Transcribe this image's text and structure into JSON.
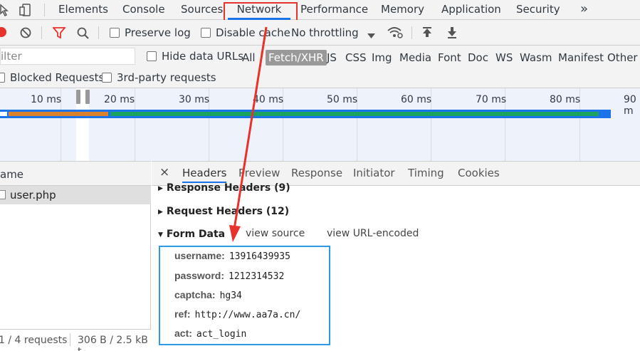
{
  "toolbar_tabs": [
    "Elements",
    "Console",
    "Sources",
    "Network",
    "Performance",
    "Memory",
    "Application",
    "Security"
  ],
  "more_tabs": "»",
  "network_toolbar": {
    "preserve_log": "Preserve log",
    "disable_cache": "Disable cache",
    "throttling": "No throttling"
  },
  "filter": {
    "placeholder": "ilter",
    "hide_data_urls": "Hide data URLs",
    "types": [
      "All",
      "Fetch/XHR",
      "JS",
      "CSS",
      "Img",
      "Media",
      "Font",
      "Doc",
      "WS",
      "Wasm",
      "Manifest",
      "Other"
    ],
    "active_type": "Fetch/XHR",
    "blocked_requests": "Blocked Requests",
    "third_party": "3rd-party requests"
  },
  "timeline": {
    "ticks": [
      "10 ms",
      "20 ms",
      "30 ms",
      "40 ms",
      "50 ms",
      "60 ms",
      "70 ms",
      "80 ms",
      "90 m"
    ]
  },
  "request_list": {
    "header": "ame",
    "items": [
      "user.php"
    ],
    "status": "1 / 4 requests",
    "transferred": "306 B / 2.5 kB t"
  },
  "details": {
    "close": "×",
    "tabs": [
      "Headers",
      "Preview",
      "Response",
      "Initiator",
      "Timing",
      "Cookies"
    ],
    "response_headers": "Response Headers (9)",
    "request_headers": "Request Headers (12)",
    "form_data": "Form Data",
    "view_source": "view source",
    "view_url_encoded": "view URL-encoded",
    "fields": [
      {
        "key": "username:",
        "value": "13916439935"
      },
      {
        "key": "password:",
        "value": "1212314532"
      },
      {
        "key": "captcha:",
        "value": "hg34"
      },
      {
        "key": "ref:",
        "value": "http://www.aa7a.cn/"
      },
      {
        "key": "act:",
        "value": "act_login"
      }
    ]
  },
  "colors": {
    "accent": "#1a73e8",
    "annotation": "#e8322b",
    "waterfall_green": "#1aa260",
    "waterfall_orange": "#d9822b",
    "waterfall_blue": "#1a73e8"
  }
}
